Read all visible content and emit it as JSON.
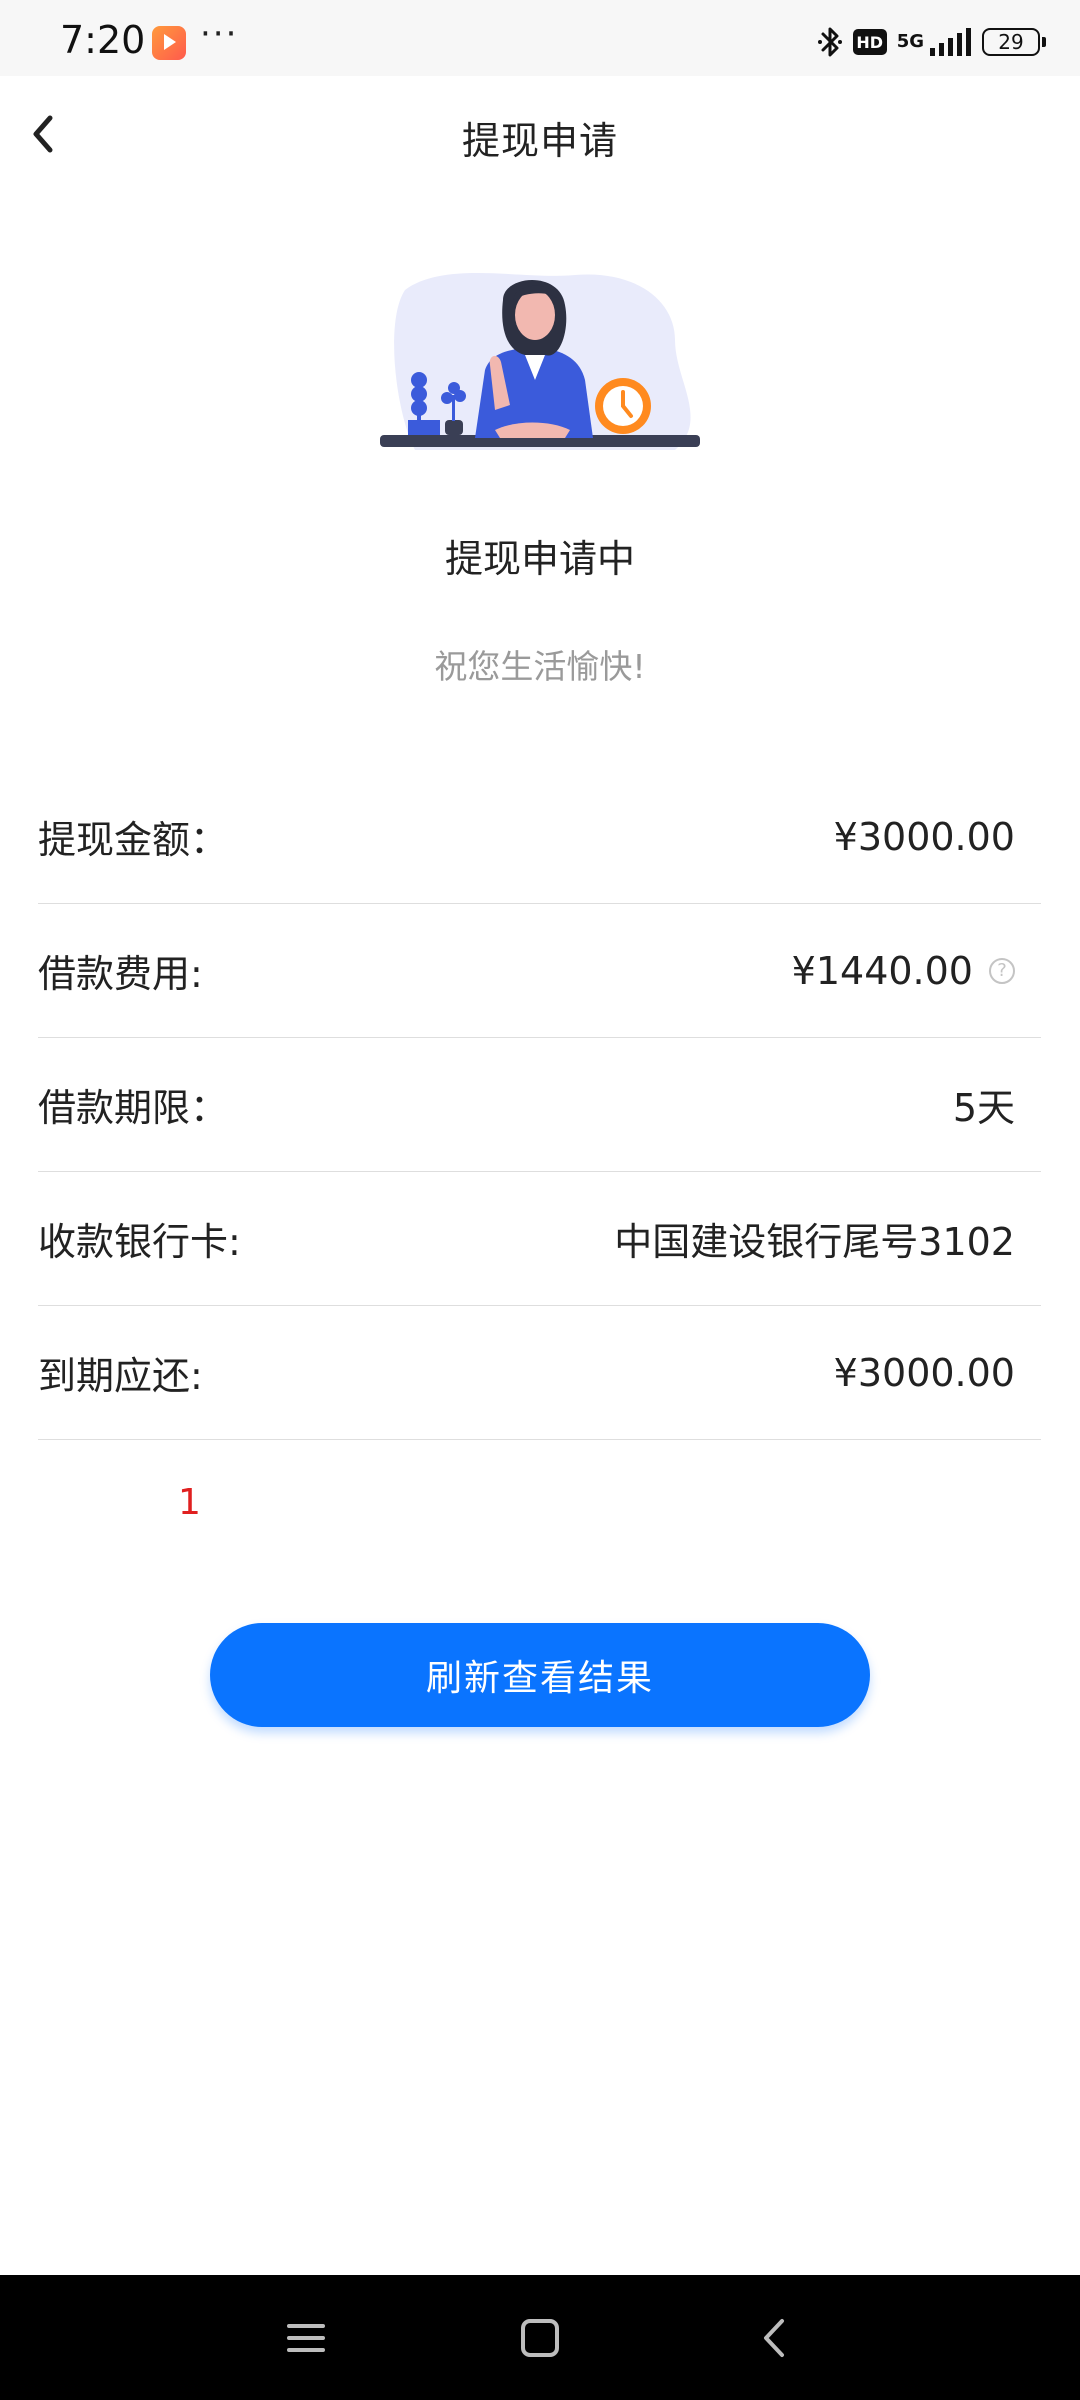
{
  "status_bar": {
    "time": "7:20",
    "app_icon": "video-app-icon",
    "more": "···",
    "hd_badge": "HD",
    "network": "5G",
    "battery_level": "29"
  },
  "header": {
    "title": "提现申请",
    "back_icon": "chevron-left-icon"
  },
  "status": {
    "title": "提现申请中",
    "subtitle": "祝您生活愉快!"
  },
  "details": [
    {
      "label": "提现金额：",
      "value": "¥3000.00"
    },
    {
      "label": "借款费用:",
      "value": "¥1440.00",
      "icon": "help-circle-icon"
    },
    {
      "label": "借款期限：",
      "value": "5天"
    },
    {
      "label": "收款银行卡:",
      "value": "中国建设银行尾号3102"
    },
    {
      "label": "到期应还:",
      "value": "¥3000.00"
    }
  ],
  "note": "1",
  "refresh_button": "刷新查看结果",
  "nav_bar": {
    "menu": "menu-icon",
    "home": "home-icon",
    "back": "back-icon"
  },
  "colors": {
    "primary": "#0a74ff",
    "note_red": "#e02020",
    "muted_text": "#9a9a9a",
    "divider": "#dedede"
  }
}
